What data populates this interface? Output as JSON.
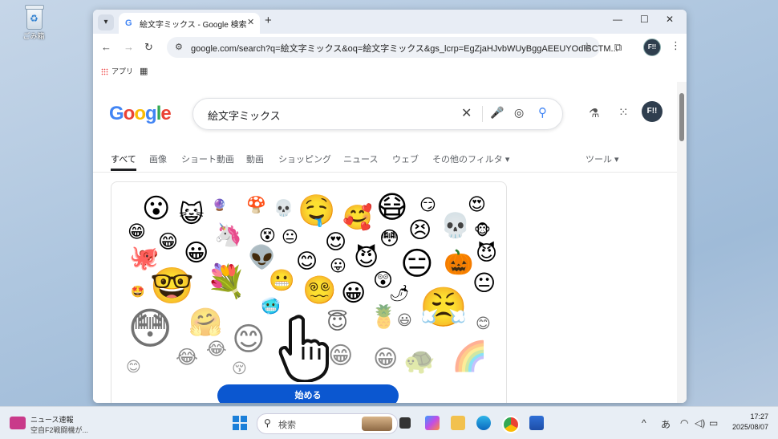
{
  "desktop": {
    "recycle_bin_label": "ごみ箱"
  },
  "browser": {
    "tab_title": "絵文字ミックス - Google 検索",
    "url": "google.com/search?q=絵文字ミックス&oq=絵文字ミックス&gs_lcrp=EgZjaHJvbWUyBggAEEUYOdIBCTM...",
    "profile_initials": "F!!",
    "bookmarks": {
      "apps_label": "アプリ"
    }
  },
  "google": {
    "query": "絵文字ミックス",
    "account_initials": "F!!",
    "tabs": [
      {
        "label": "すべて",
        "active": true
      },
      {
        "label": "画像"
      },
      {
        "label": "ショート動画"
      },
      {
        "label": "動画"
      },
      {
        "label": "ショッピング"
      },
      {
        "label": "ニュース"
      },
      {
        "label": "ウェブ"
      },
      {
        "label": "その他のフィルタ ▾"
      }
    ],
    "tools_label": "ツール ▾",
    "start_button": "始める"
  },
  "taskbar": {
    "news_title": "ニュース速報",
    "news_subtitle": "空自F2戦闘機が...",
    "search_placeholder": "検索",
    "ime": "あ",
    "time": "17:27",
    "date": "2025/08/07"
  },
  "colors": {
    "google_blue": "#0b57d0",
    "taskbar": "#e8eef5"
  }
}
